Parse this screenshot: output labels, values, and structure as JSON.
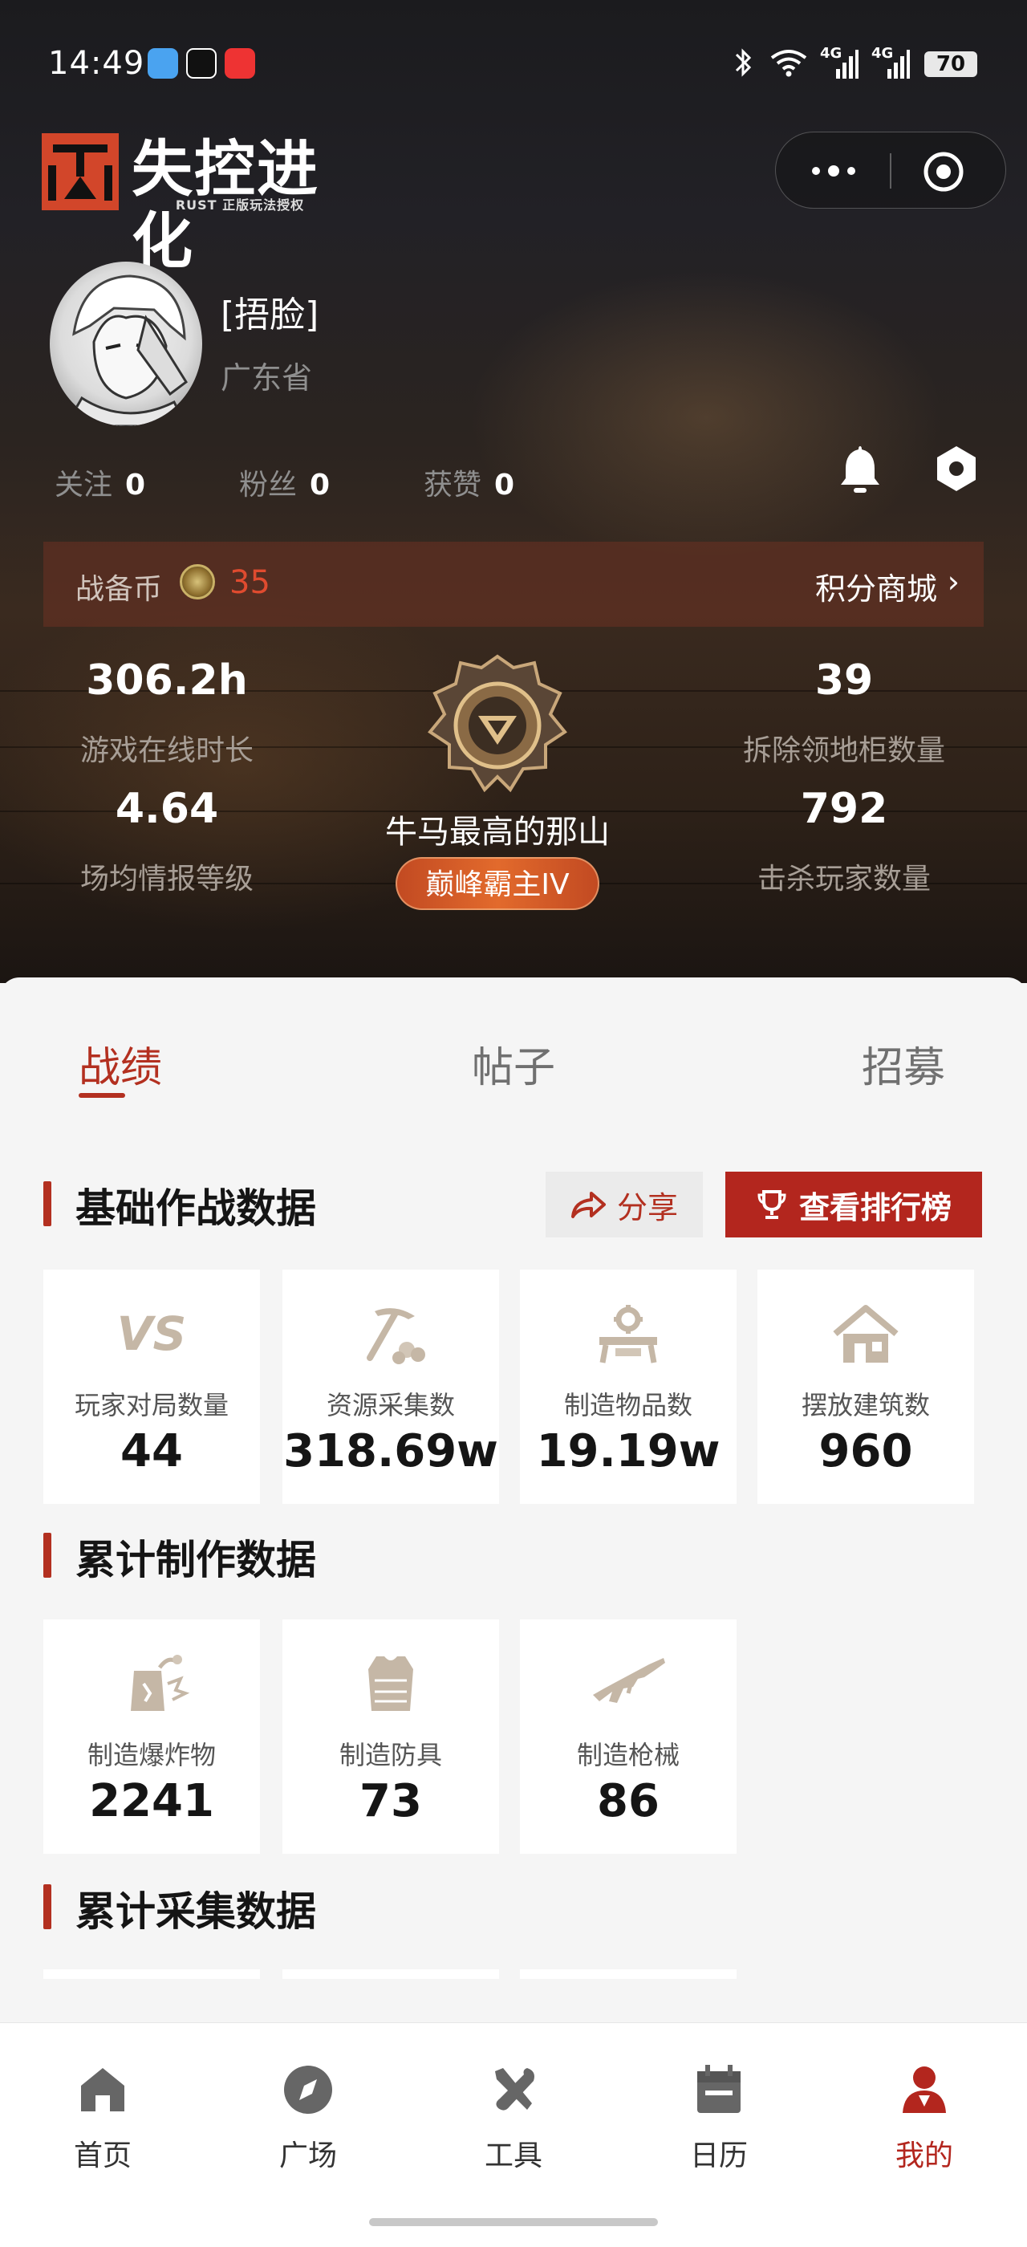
{
  "status_bar": {
    "time": "14:49",
    "battery": "70",
    "network_1": "4G",
    "network_2": "4G"
  },
  "header": {
    "logo_text": "失控进化",
    "logo_sub": "RUST 正版玩法授权",
    "more_icon": "more-dots-icon",
    "close_icon": "target-close-icon"
  },
  "profile": {
    "username": "[捂脸]",
    "region": "广东省",
    "follow_label": "关注",
    "follow_count": "0",
    "fans_label": "粉丝",
    "fans_count": "0",
    "likes_label": "获赞",
    "likes_count": "0"
  },
  "coin": {
    "label": "战备币",
    "value": "35",
    "mall_label": "积分商城",
    "chevron": "›"
  },
  "stats": {
    "online_time": "306.2h",
    "online_time_label": "游戏在线时长",
    "intel_level": "4.64",
    "intel_level_label": "场均情报等级",
    "cabinets": "39",
    "cabinets_label": "拆除领地柜数量",
    "kills": "792",
    "kills_label": "击杀玩家数量",
    "rank_name": "牛马最高的那山",
    "rank_tier": "巅峰霸主IV"
  },
  "tabs": [
    {
      "label": "战绩"
    },
    {
      "label": "帖子"
    },
    {
      "label": "招募"
    }
  ],
  "sections": {
    "basic_title": "基础作战数据",
    "share_label": "分享",
    "leaderboard_label": "查看排行榜",
    "craft_title": "累计制作数据",
    "gather_title": "累计采集数据"
  },
  "basic_cards": [
    {
      "label": "玩家对局数量",
      "value": "44",
      "icon": "vs-icon",
      "icon_text": "VS"
    },
    {
      "label": "资源采集数",
      "value": "318.69w",
      "icon": "pickaxe-icon"
    },
    {
      "label": "制造物品数",
      "value": "19.19w",
      "icon": "workbench-icon"
    },
    {
      "label": "摆放建筑数",
      "value": "960",
      "icon": "house-icon"
    }
  ],
  "craft_cards": [
    {
      "label": "制造爆炸物",
      "value": "2241",
      "icon": "explosive-icon"
    },
    {
      "label": "制造防具",
      "value": "73",
      "icon": "armor-vest-icon"
    },
    {
      "label": "制造枪械",
      "value": "86",
      "icon": "rifle-icon"
    }
  ],
  "bottom_nav": [
    {
      "label": "首页",
      "icon": "home-icon"
    },
    {
      "label": "广场",
      "icon": "compass-icon"
    },
    {
      "label": "工具",
      "icon": "tools-icon"
    },
    {
      "label": "日历",
      "icon": "calendar-icon"
    },
    {
      "label": "我的",
      "icon": "profile-icon"
    }
  ],
  "colors": {
    "accent": "#b3261e",
    "coin_red": "#e04b2f",
    "tier_orange": "#e26a2c"
  }
}
